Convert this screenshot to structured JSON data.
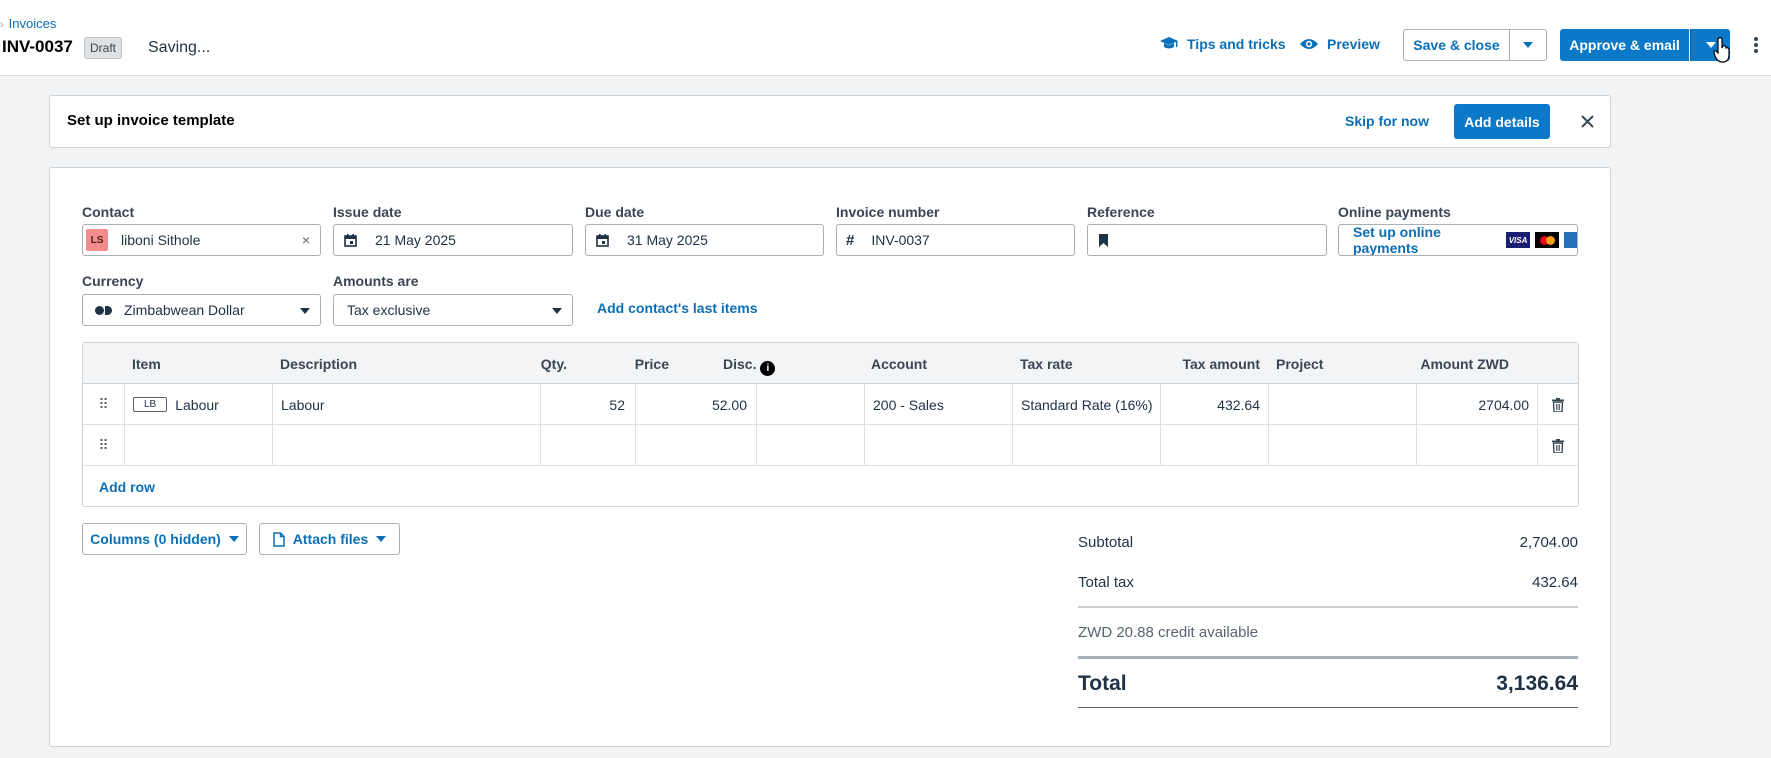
{
  "header": {
    "breadcrumb": "Invoices",
    "invoice_id": "INV-0037",
    "status_badge": "Draft",
    "saving_text": "Saving...",
    "tips_label": "Tips and tricks",
    "preview_label": "Preview",
    "save_close_label": "Save & close",
    "approve_label": "Approve & email"
  },
  "banner": {
    "title": "Set up invoice template",
    "skip_label": "Skip for now",
    "add_details_label": "Add details"
  },
  "form": {
    "contact_label": "Contact",
    "contact_initials": "LS",
    "contact_value": "liboni Sithole",
    "issue_date_label": "Issue date",
    "issue_date_value": "21 May 2025",
    "due_date_label": "Due date",
    "due_date_value": "31 May 2025",
    "invoice_number_label": "Invoice number",
    "invoice_number_value": "INV-0037",
    "reference_label": "Reference",
    "reference_value": "",
    "online_payments_label": "Online payments",
    "online_payments_link": "Set up online payments",
    "visa_label": "VISA",
    "currency_label": "Currency",
    "currency_value": "Zimbabwean Dollar",
    "amounts_are_label": "Amounts are",
    "amounts_are_value": "Tax exclusive",
    "add_last_items_label": "Add contact's last items"
  },
  "table": {
    "columns": [
      "Item",
      "Description",
      "Qty.",
      "Price",
      "Disc.",
      "Account",
      "Tax rate",
      "Tax amount",
      "Project",
      "Amount ZWD"
    ],
    "rows": [
      {
        "item_code": "LB",
        "item": "Labour",
        "description": "Labour",
        "qty": "52",
        "price": "52.00",
        "disc": "",
        "account": "200 - Sales",
        "tax_rate": "Standard Rate (16%)",
        "tax_amount": "432.64",
        "project": "",
        "amount": "2704.00"
      },
      {
        "item_code": "",
        "item": "",
        "description": "",
        "qty": "",
        "price": "",
        "disc": "",
        "account": "",
        "tax_rate": "",
        "tax_amount": "",
        "project": "",
        "amount": ""
      }
    ],
    "add_row_label": "Add row"
  },
  "actions": {
    "columns_label": "Columns (0 hidden)",
    "attach_label": "Attach files"
  },
  "totals": {
    "subtotal_label": "Subtotal",
    "subtotal_value": "2,704.00",
    "total_tax_label": "Total tax",
    "total_tax_value": "432.64",
    "credit_text": "ZWD 20.88 credit available",
    "total_label": "Total",
    "total_value": "3,136.64"
  },
  "colors": {
    "primary": "#0b78c8",
    "link": "#0b6fb8"
  }
}
